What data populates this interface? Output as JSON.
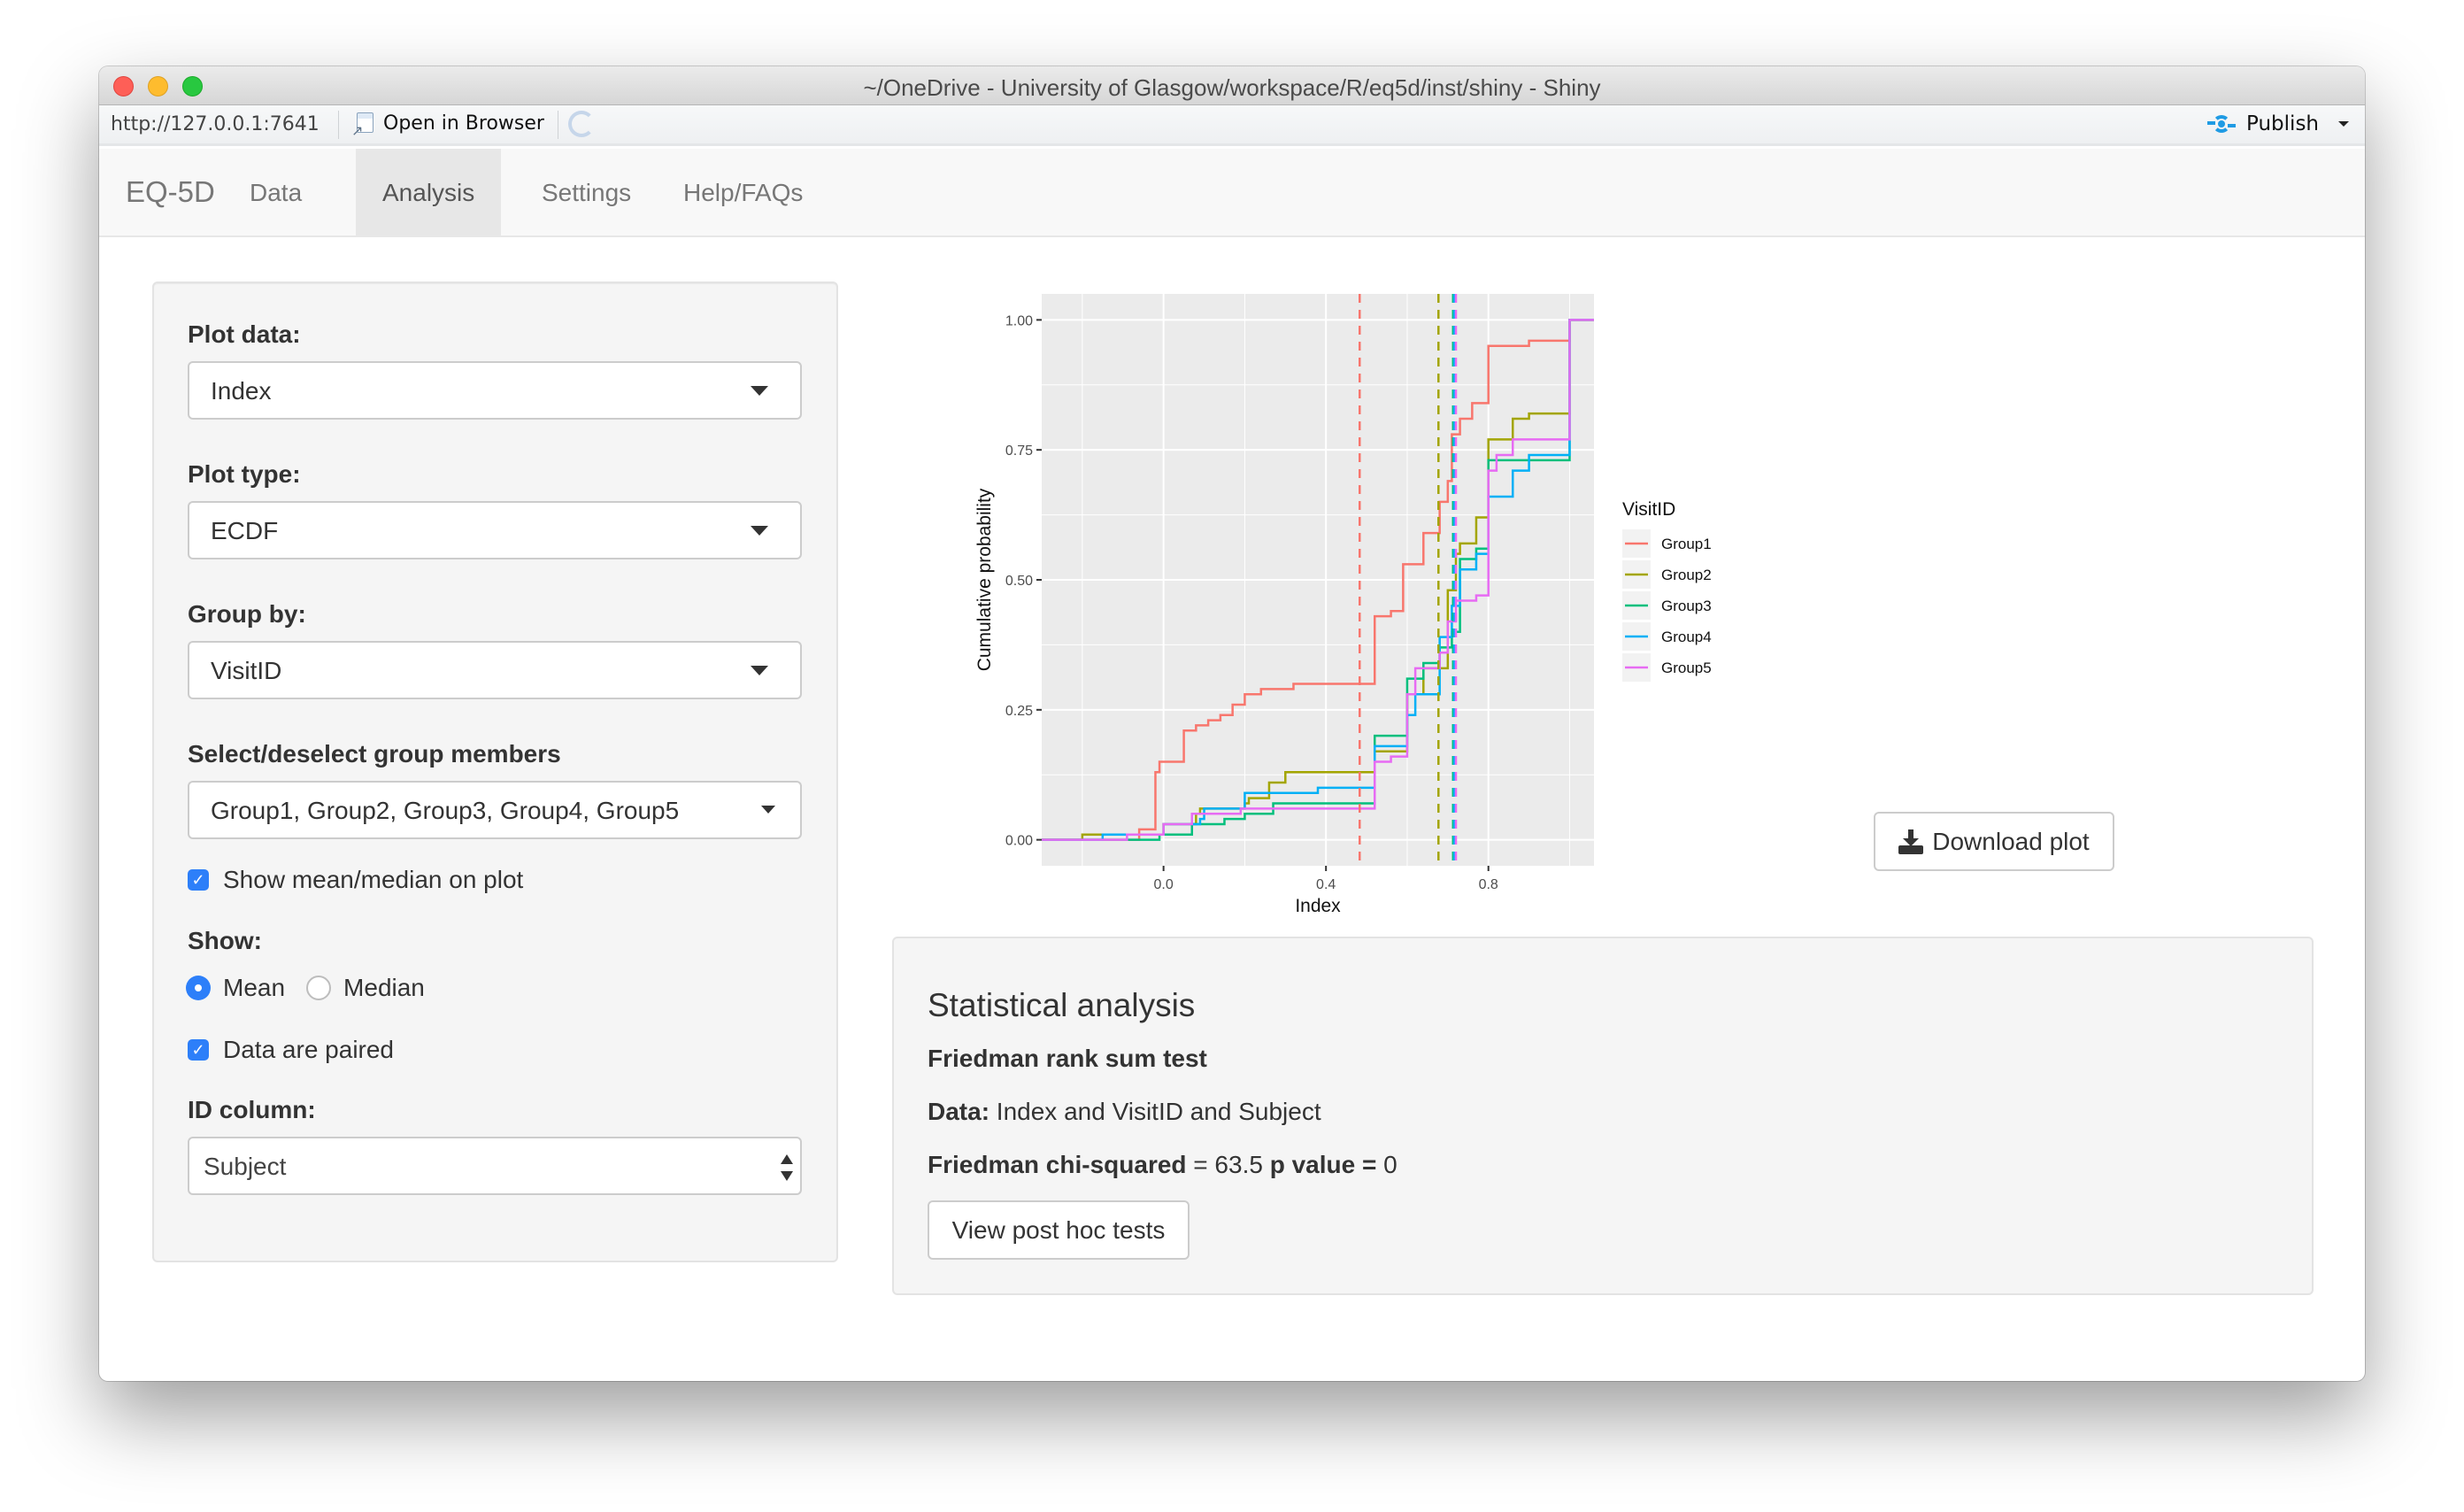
{
  "window": {
    "title": "~/OneDrive - University of Glasgow/workspace/R/eq5d/inst/shiny - Shiny"
  },
  "toolbar": {
    "url": "http://127.0.0.1:7641",
    "open_in_browser": "Open in Browser",
    "publish": "Publish"
  },
  "navbar": {
    "brand": "EQ-5D",
    "tabs": [
      {
        "label": "Data",
        "active": false
      },
      {
        "label": "Analysis",
        "active": true
      },
      {
        "label": "Settings",
        "active": false
      },
      {
        "label": "Help/FAQs",
        "active": false
      }
    ]
  },
  "sidebar": {
    "plot_data": {
      "label": "Plot data:",
      "value": "Index"
    },
    "plot_type": {
      "label": "Plot type:",
      "value": "ECDF"
    },
    "group_by": {
      "label": "Group by:",
      "value": "VisitID"
    },
    "group_members": {
      "label": "Select/deselect group members",
      "value": "Group1, Group2, Group3, Group4, Group5"
    },
    "show_mean_median": {
      "label": "Show mean/median on plot",
      "checked": true
    },
    "show": {
      "label": "Show:",
      "options": [
        {
          "label": "Mean",
          "selected": true
        },
        {
          "label": "Median",
          "selected": false
        }
      ]
    },
    "paired": {
      "label": "Data are paired",
      "checked": true
    },
    "id_column": {
      "label": "ID column:",
      "value": "Subject"
    }
  },
  "download_button": "Download plot",
  "stats": {
    "title": "Statistical analysis",
    "test_name": "Friedman rank sum test",
    "data_label": "Data:",
    "data_value": "Index and VisitID and Subject",
    "stat_label": "Friedman chi-squared",
    "stat_value": "= 63.5",
    "p_label": "p value =",
    "p_value": "0",
    "posthoc_button": "View post hoc tests"
  },
  "chart_data": {
    "type": "line",
    "subtype": "ecdf-step",
    "title": "",
    "xlabel": "Index",
    "ylabel": "Cumulative probability",
    "xlim": [
      -0.3,
      1.06
    ],
    "ylim": [
      -0.05,
      1.05
    ],
    "xticks": [
      0.0,
      0.4,
      0.8
    ],
    "xtick_labels": [
      "0.0",
      "0.4",
      "0.8"
    ],
    "yticks": [
      0.0,
      0.25,
      0.5,
      0.75,
      1.0
    ],
    "ytick_labels": [
      "0.00",
      "0.25",
      "0.50",
      "0.75",
      "1.00"
    ],
    "grid": true,
    "legend": {
      "title": "VisitID",
      "position": "right"
    },
    "series": [
      {
        "name": "Group1",
        "color": "#F8766D",
        "mean": 0.483,
        "steps": [
          [
            -0.3,
            0
          ],
          [
            -0.06,
            0.02
          ],
          [
            -0.02,
            0.13
          ],
          [
            -0.01,
            0.15
          ],
          [
            0.05,
            0.16
          ],
          [
            0.05,
            0.21
          ],
          [
            0.08,
            0.22
          ],
          [
            0.11,
            0.23
          ],
          [
            0.14,
            0.24
          ],
          [
            0.17,
            0.26
          ],
          [
            0.2,
            0.28
          ],
          [
            0.24,
            0.29
          ],
          [
            0.32,
            0.3
          ],
          [
            0.52,
            0.43
          ],
          [
            0.56,
            0.44
          ],
          [
            0.59,
            0.49
          ],
          [
            0.59,
            0.53
          ],
          [
            0.64,
            0.59
          ],
          [
            0.68,
            0.65
          ],
          [
            0.7,
            0.69
          ],
          [
            0.71,
            0.78
          ],
          [
            0.73,
            0.81
          ],
          [
            0.76,
            0.84
          ],
          [
            0.8,
            0.95
          ],
          [
            0.9,
            0.96
          ],
          [
            1.0,
            1.0
          ],
          [
            1.06,
            1.0
          ]
        ]
      },
      {
        "name": "Group2",
        "color": "#A3A500",
        "mean": 0.677,
        "steps": [
          [
            -0.3,
            0
          ],
          [
            -0.2,
            0.01
          ],
          [
            -0.04,
            0.01
          ],
          [
            0.0,
            0.03
          ],
          [
            0.08,
            0.05
          ],
          [
            0.09,
            0.06
          ],
          [
            0.2,
            0.07
          ],
          [
            0.21,
            0.08
          ],
          [
            0.26,
            0.11
          ],
          [
            0.3,
            0.13
          ],
          [
            0.52,
            0.17
          ],
          [
            0.6,
            0.28
          ],
          [
            0.64,
            0.33
          ],
          [
            0.7,
            0.48
          ],
          [
            0.72,
            0.55
          ],
          [
            0.73,
            0.57
          ],
          [
            0.77,
            0.62
          ],
          [
            0.8,
            0.77
          ],
          [
            0.86,
            0.81
          ],
          [
            0.9,
            0.82
          ],
          [
            1.0,
            1.0
          ],
          [
            1.06,
            1.0
          ]
        ]
      },
      {
        "name": "Group3",
        "color": "#00BF7D",
        "mean": 0.713,
        "steps": [
          [
            -0.3,
            0
          ],
          [
            -0.01,
            0.01
          ],
          [
            0.07,
            0.03
          ],
          [
            0.15,
            0.04
          ],
          [
            0.2,
            0.05
          ],
          [
            0.27,
            0.07
          ],
          [
            0.52,
            0.2
          ],
          [
            0.6,
            0.31
          ],
          [
            0.64,
            0.34
          ],
          [
            0.68,
            0.37
          ],
          [
            0.71,
            0.4
          ],
          [
            0.73,
            0.54
          ],
          [
            0.77,
            0.56
          ],
          [
            0.8,
            0.73
          ],
          [
            1.0,
            1.0
          ],
          [
            1.06,
            1.0
          ]
        ]
      },
      {
        "name": "Group4",
        "color": "#00B0F6",
        "mean": 0.716,
        "steps": [
          [
            -0.3,
            0
          ],
          [
            -0.15,
            0.01
          ],
          [
            0.0,
            0.03
          ],
          [
            0.09,
            0.04
          ],
          [
            0.1,
            0.06
          ],
          [
            0.2,
            0.09
          ],
          [
            0.38,
            0.1
          ],
          [
            0.52,
            0.18
          ],
          [
            0.6,
            0.24
          ],
          [
            0.62,
            0.28
          ],
          [
            0.68,
            0.39
          ],
          [
            0.71,
            0.45
          ],
          [
            0.73,
            0.52
          ],
          [
            0.77,
            0.55
          ],
          [
            0.8,
            0.66
          ],
          [
            0.86,
            0.71
          ],
          [
            0.9,
            0.74
          ],
          [
            1.0,
            1.0
          ],
          [
            1.06,
            1.0
          ]
        ]
      },
      {
        "name": "Group5",
        "color": "#E76BF3",
        "mean": 0.72,
        "steps": [
          [
            -0.3,
            0
          ],
          [
            -0.09,
            0.01
          ],
          [
            0.0,
            0.03
          ],
          [
            0.07,
            0.05
          ],
          [
            0.19,
            0.06
          ],
          [
            0.52,
            0.15
          ],
          [
            0.56,
            0.16
          ],
          [
            0.6,
            0.28
          ],
          [
            0.62,
            0.33
          ],
          [
            0.68,
            0.36
          ],
          [
            0.7,
            0.42
          ],
          [
            0.72,
            0.46
          ],
          [
            0.77,
            0.47
          ],
          [
            0.8,
            0.71
          ],
          [
            0.82,
            0.74
          ],
          [
            0.86,
            0.77
          ],
          [
            1.0,
            1.0
          ],
          [
            1.06,
            1.0
          ]
        ]
      }
    ]
  }
}
